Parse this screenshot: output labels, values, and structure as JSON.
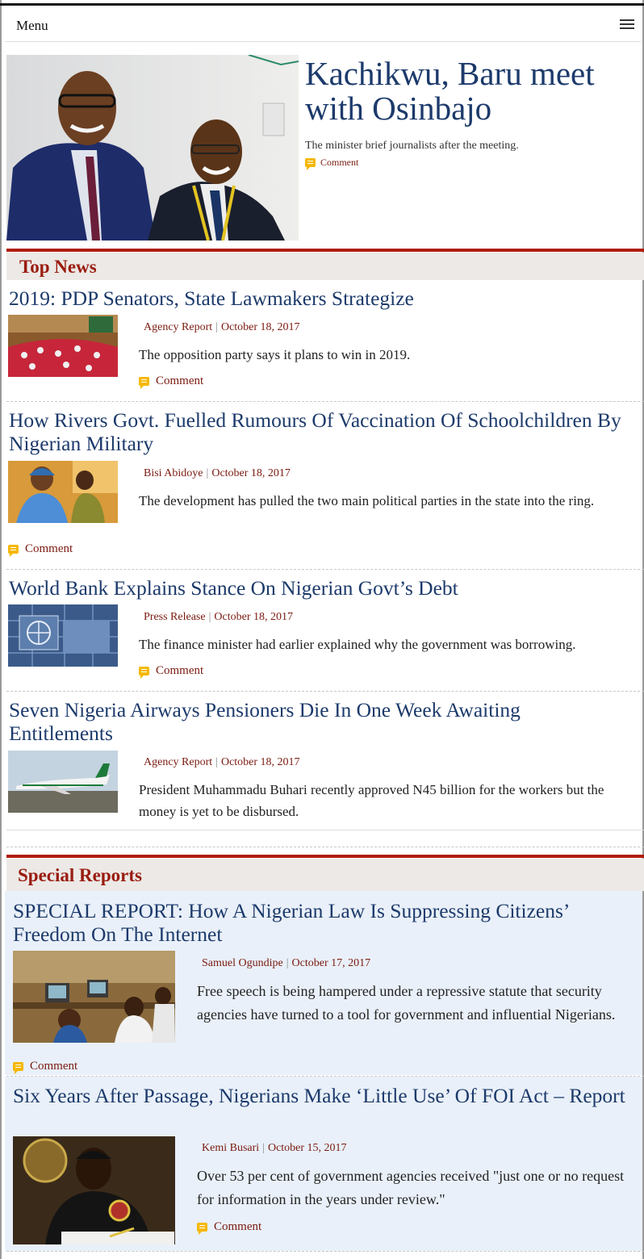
{
  "menu": {
    "label": "Menu",
    "icon": "hamburger-icon"
  },
  "hero": {
    "title": "Kachikwu, Baru meet with Osinbajo",
    "subtitle": "The minister brief journalists after the meeting.",
    "comment": "Comment"
  },
  "top_news": {
    "heading": "Top News",
    "articles": [
      {
        "title": "2019: PDP Senators, State Lawmakers Strategize",
        "author": "Agency Report",
        "date": "October 18, 2017",
        "description": "The opposition party says it plans to win in 2019.",
        "comment": "Comment"
      },
      {
        "title": "How Rivers Govt. Fuelled Rumours Of Vaccination Of Schoolchildren By Nigerian Military",
        "author": "Bisi Abidoye",
        "date": "October 18, 2017",
        "description": "The development has pulled the two main political parties in the state into the ring.",
        "comment": "Comment"
      },
      {
        "title": "World Bank Explains Stance On Nigerian Govt’s Debt",
        "author": "Press Release",
        "date": "October 18, 2017",
        "description": "The finance minister had earlier explained why the government was borrowing.",
        "comment": "Comment"
      },
      {
        "title": "Seven Nigeria Airways Pensioners Die In One Week Awaiting Entitlements",
        "author": "Agency Report",
        "date": "October 18, 2017",
        "description": "President Muhammadu Buhari recently approved N45 billion for the workers but the money is yet to be disbursed."
      }
    ]
  },
  "special_reports": {
    "heading": "Special Reports",
    "articles": [
      {
        "title": "SPECIAL REPORT: How A Nigerian Law Is Suppressing Citizens’ Freedom On The Internet",
        "author": "Samuel Ogundipe",
        "date": "October 17, 2017",
        "description": "Free speech is being hampered under a repressive statute that security agencies have turned to a tool for government and influential Nigerians.",
        "comment": "Comment"
      },
      {
        "title": "Six Years After Passage, Nigerians Make ‘Little Use’ Of FOI Act – Report",
        "author": "Kemi Busari",
        "date": "October 15, 2017",
        "description": "Over 53 per cent of government agencies received \"just one or no request for information in the years under review.\"",
        "comment": "Comment"
      }
    ]
  },
  "colors": {
    "headline": "#1c3a6b",
    "section_accent": "#b01e0c",
    "meta": "#7a1a10",
    "comment_icon": "#f5b800",
    "special_bg": "#e9f0f9"
  }
}
